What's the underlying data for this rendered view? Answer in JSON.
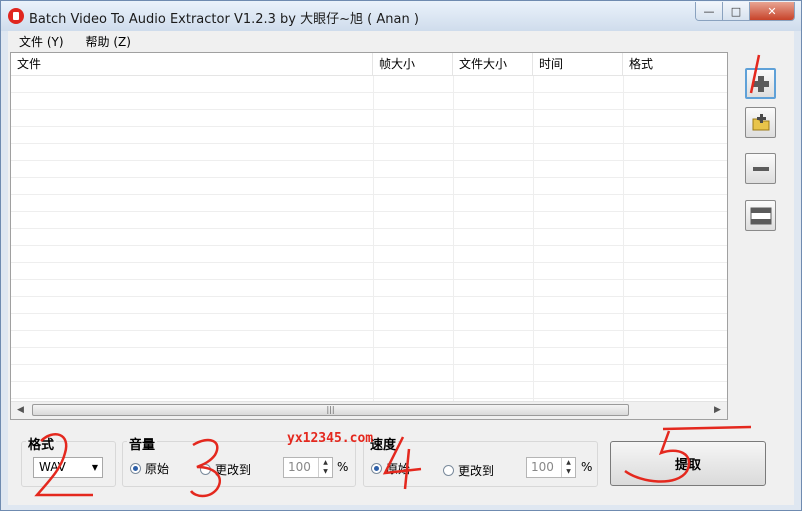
{
  "window": {
    "title": "Batch Video To Audio Extractor V1.2.3 by 大眼仔~旭 ( Anan )"
  },
  "menu": [
    {
      "label": "文件 (Y)"
    },
    {
      "label": "帮助 (Z)"
    }
  ],
  "list": {
    "columns": [
      "文件",
      "帧大小",
      "文件大小",
      "时间",
      "格式"
    ]
  },
  "format": {
    "label": "格式",
    "value": "WAV"
  },
  "volume": {
    "label": "音量",
    "original": "原始",
    "change": "更改到",
    "value": "100",
    "unit": "%"
  },
  "speed": {
    "label": "速度",
    "original": "原始",
    "change": "更改到",
    "value": "100",
    "unit": "%"
  },
  "extract": {
    "label": "提取"
  },
  "watermark": "yx12345.com",
  "annotations": [
    "1",
    "2",
    "3",
    "4",
    "5"
  ],
  "colors": {
    "annotation": "#e4281e",
    "title_bar": "#cfdcec",
    "focus": "#5fa1d8"
  },
  "icons": {
    "add_file": "plus-icon",
    "add_folder": "folder-add-icon",
    "remove": "minus-icon",
    "clear": "clear-list-icon"
  }
}
